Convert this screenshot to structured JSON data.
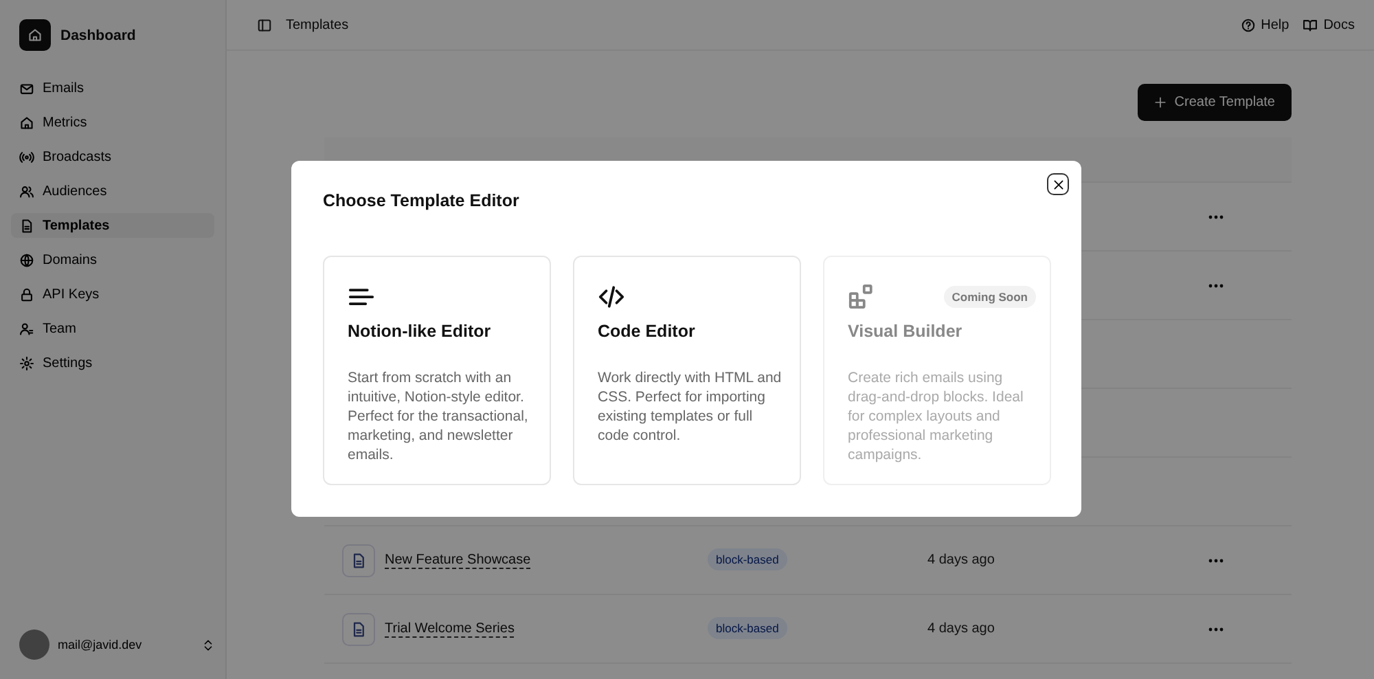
{
  "sidebar": {
    "brand": "Dashboard",
    "items": [
      {
        "label": "Emails",
        "selected": false
      },
      {
        "label": "Metrics",
        "selected": false
      },
      {
        "label": "Broadcasts",
        "selected": false
      },
      {
        "label": "Audiences",
        "selected": false
      },
      {
        "label": "Templates",
        "selected": true
      },
      {
        "label": "Domains",
        "selected": false
      },
      {
        "label": "API Keys",
        "selected": false
      },
      {
        "label": "Team",
        "selected": false
      },
      {
        "label": "Settings",
        "selected": false
      }
    ],
    "user": {
      "email": "mail@javid.dev"
    }
  },
  "topbar": {
    "breadcrumb": "Templates",
    "links": [
      {
        "label": "Help"
      },
      {
        "label": "Docs"
      }
    ]
  },
  "create_button": "Create Template",
  "table": {
    "rows": [
      {
        "kind": "covered"
      },
      {
        "kind": "covered"
      },
      {
        "kind": "hidden"
      },
      {
        "kind": "hidden"
      },
      {
        "kind": "hidden"
      },
      {
        "kind": "full",
        "name": "New Feature Showcase",
        "editor": "block-based",
        "created": "4 days ago"
      },
      {
        "kind": "full",
        "name": "Trial Welcome Series",
        "editor": "block-based",
        "created": "4 days ago"
      }
    ]
  },
  "modal": {
    "title": "Choose Template Editor",
    "cards": [
      {
        "title": "Notion-like Editor",
        "description": "Start from scratch with an intuitive, Notion-style editor. Perfect for the transactional, marketing, and newsletter emails.",
        "disabled": false
      },
      {
        "title": "Code Editor",
        "description": "Work directly with HTML and CSS. Perfect for importing existing templates or full code control.",
        "disabled": false
      },
      {
        "title": "Visual Builder",
        "description": "Create rich emails using drag-and-drop blocks. Ideal for complex layouts and professional marketing campaigns.",
        "disabled": true,
        "badge": "Coming Soon"
      }
    ]
  }
}
